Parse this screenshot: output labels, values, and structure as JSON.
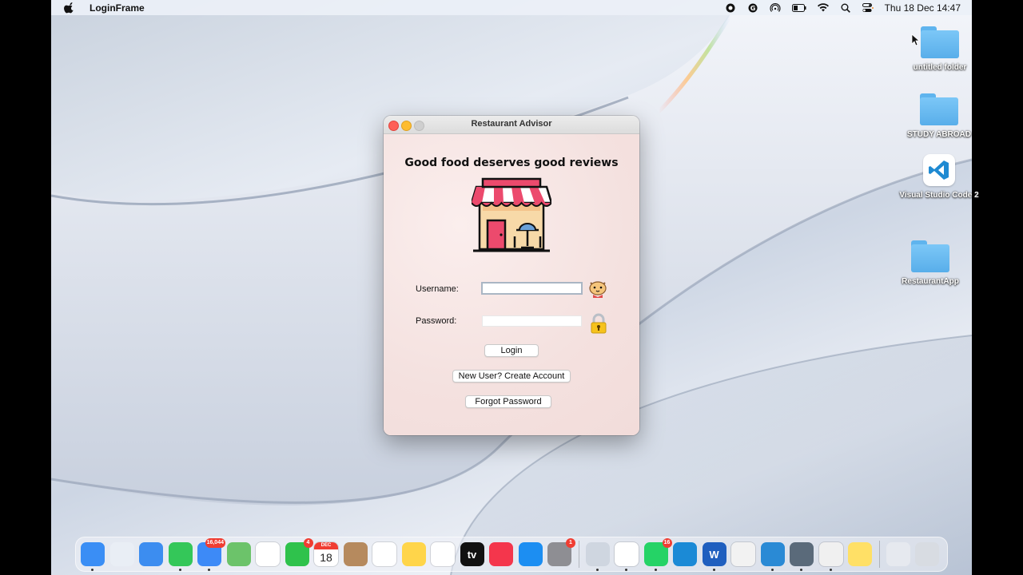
{
  "menubar": {
    "app_name": "LoginFrame",
    "clock": "Thu 18 Dec  14:47"
  },
  "desktop": {
    "icons": [
      {
        "label": "untitled folder",
        "type": "folder"
      },
      {
        "label": "STUDY ABROAD",
        "type": "folder"
      },
      {
        "label": "Visual Studio Code 2",
        "type": "vscode"
      },
      {
        "label": "RestaurantApp",
        "type": "folder"
      }
    ]
  },
  "window": {
    "title": "Restaurant Advisor",
    "headline": "Good food deserves good reviews",
    "username_label": "Username:",
    "username_value": "",
    "password_label": "Password:",
    "password_value": "",
    "login_button": "Login",
    "create_account_button": "New User? Create Account",
    "forgot_password_button": "Forgot Password"
  },
  "dock": {
    "items": [
      {
        "name": "finder",
        "color": "#3a8ef5",
        "running": true
      },
      {
        "name": "launchpad",
        "color": "#e9eef5"
      },
      {
        "name": "safari",
        "color": "#3c8df0"
      },
      {
        "name": "messages",
        "color": "#34c759",
        "running": true
      },
      {
        "name": "mail",
        "color": "#3d8af7",
        "badge": "16,044",
        "running": true
      },
      {
        "name": "maps",
        "color": "#6cc36a"
      },
      {
        "name": "photos",
        "color": "#ffffff"
      },
      {
        "name": "facetime",
        "color": "#2fc24c",
        "badge": "4"
      },
      {
        "name": "calendar",
        "color": "#ffffff",
        "text_top": "DEC",
        "text_main": "18"
      },
      {
        "name": "contacts",
        "color": "#b68a5e"
      },
      {
        "name": "reminders",
        "color": "#ffffff"
      },
      {
        "name": "notes",
        "color": "#ffd54a"
      },
      {
        "name": "freeform",
        "color": "#ffffff"
      },
      {
        "name": "apple-tv",
        "color": "#111111",
        "text_main": "tv"
      },
      {
        "name": "music",
        "color": "#f4364c"
      },
      {
        "name": "app-store",
        "color": "#1c8ef2"
      },
      {
        "name": "system-settings",
        "color": "#8e8e93",
        "badge": "1"
      }
    ],
    "items_right": [
      {
        "name": "preview",
        "color": "#cfd6e0",
        "running": true
      },
      {
        "name": "chrome",
        "color": "#ffffff",
        "running": true
      },
      {
        "name": "whatsapp",
        "color": "#25d366",
        "badge": "16",
        "running": true
      },
      {
        "name": "edge",
        "color": "#1b8ad6"
      },
      {
        "name": "word",
        "color": "#1f5fbf",
        "text_main": "W",
        "running": true
      },
      {
        "name": "textedit",
        "color": "#f2f2f2"
      },
      {
        "name": "vscode",
        "color": "#2a8ad5",
        "running": true
      },
      {
        "name": "quicktime",
        "color": "#5a6a7a",
        "running": true
      },
      {
        "name": "java",
        "color": "#f0f0f0",
        "running": true
      },
      {
        "name": "notes-2",
        "color": "#ffe066"
      }
    ],
    "items_end": [
      {
        "name": "downloads-stack",
        "color": "#e6e9ef"
      },
      {
        "name": "trash",
        "color": "#d8dce2"
      }
    ]
  }
}
